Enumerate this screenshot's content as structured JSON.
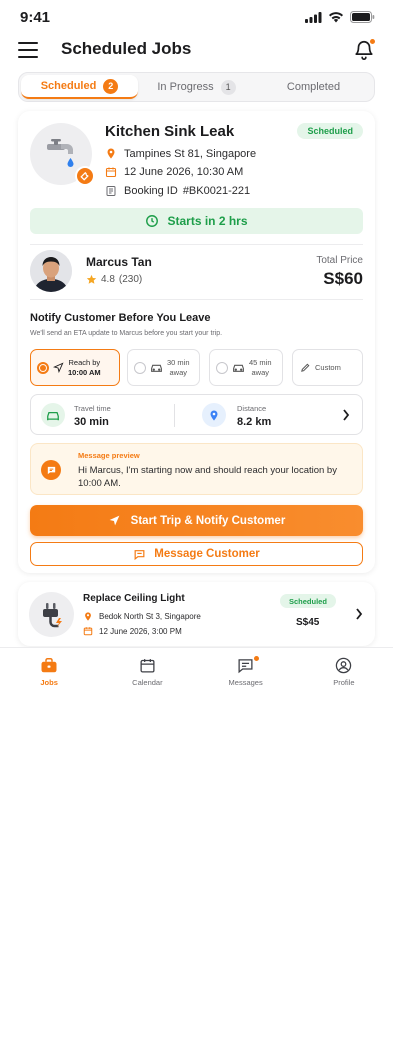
{
  "status_bar": {
    "time": "9:41"
  },
  "header": {
    "title": "Scheduled Jobs"
  },
  "tabs": [
    {
      "label": "Scheduled",
      "count": "2"
    },
    {
      "label": "In Progress",
      "count": "1"
    },
    {
      "label": "Completed"
    }
  ],
  "job1": {
    "title": "Kitchen Sink Leak",
    "status": "Scheduled",
    "location": "Tampines St 81, Singapore",
    "datetime": "12 June 2026, 10:30 AM",
    "booking_prefix": "Booking ID",
    "booking_id": "#BK0021-221",
    "starts_in": "Starts in 2 hrs",
    "customer": {
      "name": "Marcus Tan",
      "rating": "4.8",
      "reviews": "(230)"
    },
    "price_label": "Total Price",
    "price": "S$60",
    "notify": {
      "title": "Notify Customer Before You Leave",
      "subtitle": "We'll send an ETA update to Marcus before you start your trip.",
      "options": [
        {
          "line1": "Reach by",
          "line2": "10:00 AM",
          "selected": true
        },
        {
          "line1": "30 min",
          "line2": "away",
          "selected": false
        },
        {
          "line1": "45 min",
          "line2": "away",
          "selected": false
        },
        {
          "line1": "Custom",
          "selected": false
        }
      ]
    },
    "travel_time_label": "Travel time",
    "travel_time": "30 min",
    "distance_label": "Distance",
    "distance": "8.2 km",
    "message_preview_label": "Message preview",
    "message_preview": "Hi Marcus, I'm starting now and should reach your location by 10:00 AM.",
    "primary_button": "Start Trip & Notify Customer",
    "secondary_button": "Message Customer"
  },
  "job2": {
    "title": "Replace Ceiling Light",
    "location": "Bedok North St 3, Singapore",
    "datetime": "12 June 2026, 3:00 PM",
    "status": "Scheduled",
    "price": "S$45"
  },
  "bottom_nav": [
    {
      "label": "Jobs",
      "active": true
    },
    {
      "label": "Calendar"
    },
    {
      "label": "Messages"
    },
    {
      "label": "Profile"
    }
  ],
  "colors": {
    "accent": "#f47b14",
    "success": "#1e9e4a",
    "success_bg": "#e4f5e9"
  }
}
